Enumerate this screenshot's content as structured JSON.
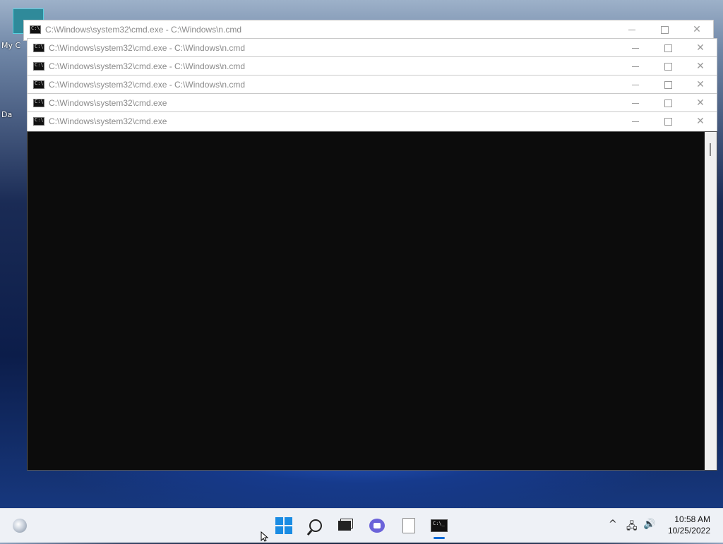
{
  "windows": [
    {
      "title": "C:\\Windows\\system32\\cmd.exe - C:\\Windows\\n.cmd"
    },
    {
      "title": "C:\\Windows\\system32\\cmd.exe - C:\\Windows\\n.cmd"
    },
    {
      "title": "C:\\Windows\\system32\\cmd.exe - C:\\Windows\\n.cmd"
    },
    {
      "title": "C:\\Windows\\system32\\cmd.exe - C:\\Windows\\n.cmd"
    },
    {
      "title": "C:\\Windows\\system32\\cmd.exe"
    },
    {
      "title": "C:\\Windows\\system32\\cmd.exe"
    }
  ],
  "window_controls": {
    "minimize": "—",
    "maximize": "□",
    "close": "✕"
  },
  "desktop": {
    "icon_label_1": "My C",
    "icon_label_2": "Da"
  },
  "taskbar": {
    "icons": [
      "widgets-icon",
      "start-icon",
      "search-icon",
      "task-view-icon",
      "teams-chat-icon",
      "notepad-icon",
      "command-prompt-icon"
    ],
    "tray": {
      "chevron": "^",
      "network": "🖧",
      "volume": "🔊"
    },
    "time": "10:58 AM",
    "date": "10/25/2022"
  }
}
